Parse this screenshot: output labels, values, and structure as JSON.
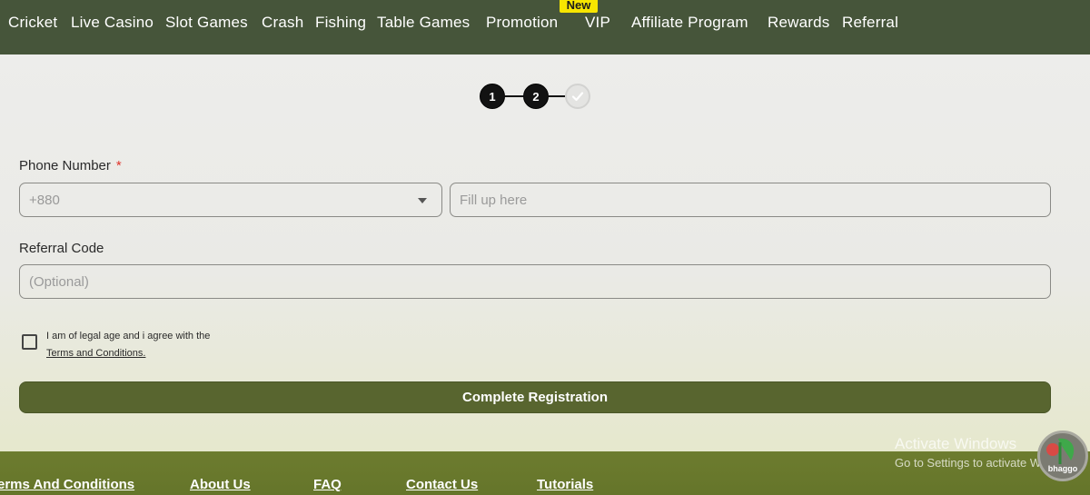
{
  "nav": {
    "items": [
      {
        "label": "Cricket"
      },
      {
        "label": "Live Casino"
      },
      {
        "label": "Slot Games"
      },
      {
        "label": "Crash"
      },
      {
        "label": "Fishing"
      },
      {
        "label": "Table Games"
      },
      {
        "label": "Promotion"
      },
      {
        "label": "VIP",
        "badge": "New"
      },
      {
        "label": "Affiliate Program"
      },
      {
        "label": "Rewards"
      },
      {
        "label": "Referral"
      }
    ],
    "badge_color": "#f7e500"
  },
  "stepper": {
    "steps": [
      "1",
      "2"
    ],
    "current": 2,
    "total": 3,
    "final_icon": "check-icon"
  },
  "form": {
    "phone_label": "Phone Number",
    "required_mark": "*",
    "country_code": "+880",
    "phone_placeholder": "Fill up here",
    "referral_label": "Referral Code",
    "referral_placeholder": "(Optional)",
    "agree_text": "I am of legal age and i agree with the",
    "terms_link": "Terms and Conditions.",
    "submit_label": "Complete Registration"
  },
  "footer": {
    "links": [
      "erms And Conditions",
      "About Us",
      "FAQ",
      "Contact Us",
      "Tutorials"
    ]
  },
  "overlay": {
    "watermark_title": "Activate Windows",
    "watermark_sub": "Go to Settings to activate Windows.",
    "badge_label": "bhaggo"
  },
  "colors": {
    "nav_bg": "#46553a",
    "button_bg": "#58652f",
    "footer_bg": "#6d7c2f",
    "required": "#e0352b"
  }
}
